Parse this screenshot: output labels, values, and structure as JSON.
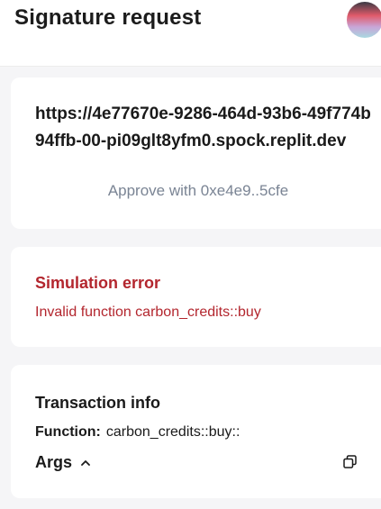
{
  "header": {
    "title": "Signature request"
  },
  "origin": {
    "url": "https://4e77670e-9286-464d-93b6-49f774b94ffb-00-pi09glt8yfm0.spock.replit.dev",
    "approve_text": "Approve with 0xe4e9..5cfe"
  },
  "simulation": {
    "title": "Simulation error",
    "message": "Invalid function carbon_credits::buy"
  },
  "transaction": {
    "title": "Transaction info",
    "function_label": "Function:",
    "function_value": "carbon_credits::buy::",
    "args_label": "Args",
    "icons": [
      "chevron-up-icon",
      "copy-icon"
    ]
  },
  "colors": {
    "error": "#b3262e",
    "muted": "#7a8494",
    "background": "#f5f5f7"
  }
}
